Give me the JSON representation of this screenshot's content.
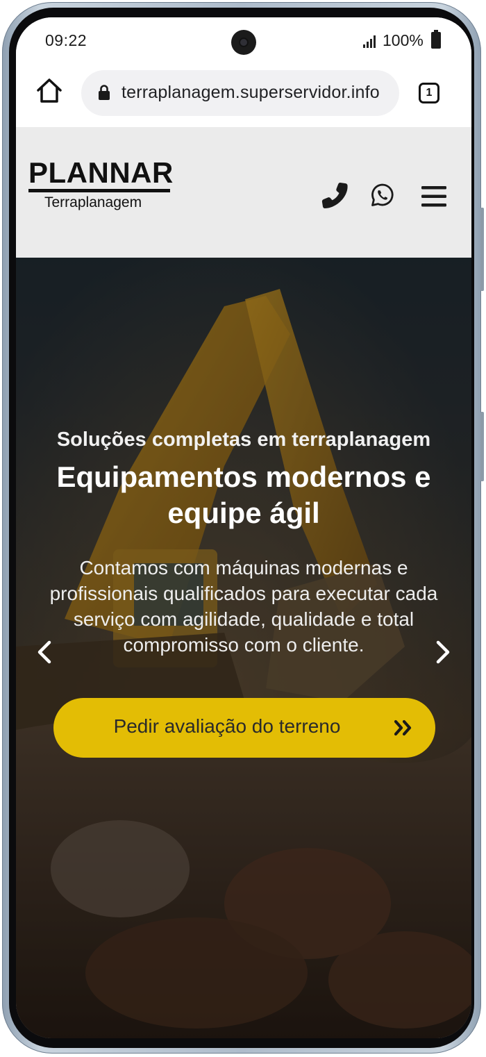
{
  "status_bar": {
    "time": "09:22",
    "battery": "100%"
  },
  "browser": {
    "url": "terraplanagem.superservidor.info",
    "tab_count": "1",
    "icons": [
      "home-icon",
      "lock-icon",
      "tabs-icon"
    ]
  },
  "header": {
    "logo_title": "PLANNAR",
    "logo_subtitle": "Terraplanagem",
    "icons": [
      "phone-icon",
      "whatsapp-icon",
      "menu-icon"
    ]
  },
  "hero": {
    "subtitle": "Soluções completas em terraplanagem",
    "title": "Equipamentos modernos e equipe ágil",
    "text": "Contamos com máquinas modernas e profissionais qualificados para executar cada serviço com agilidade, qualidade e total compromisso com o cliente.",
    "cta_label": "Pedir avaliação do terreno",
    "cta_color": "#e3bd05",
    "icons": [
      "prev-arrow-icon",
      "next-arrow-icon",
      "double-chevron-icon"
    ]
  },
  "colors": {
    "header_bg": "#ebebeb",
    "accent": "#e3bd05"
  }
}
